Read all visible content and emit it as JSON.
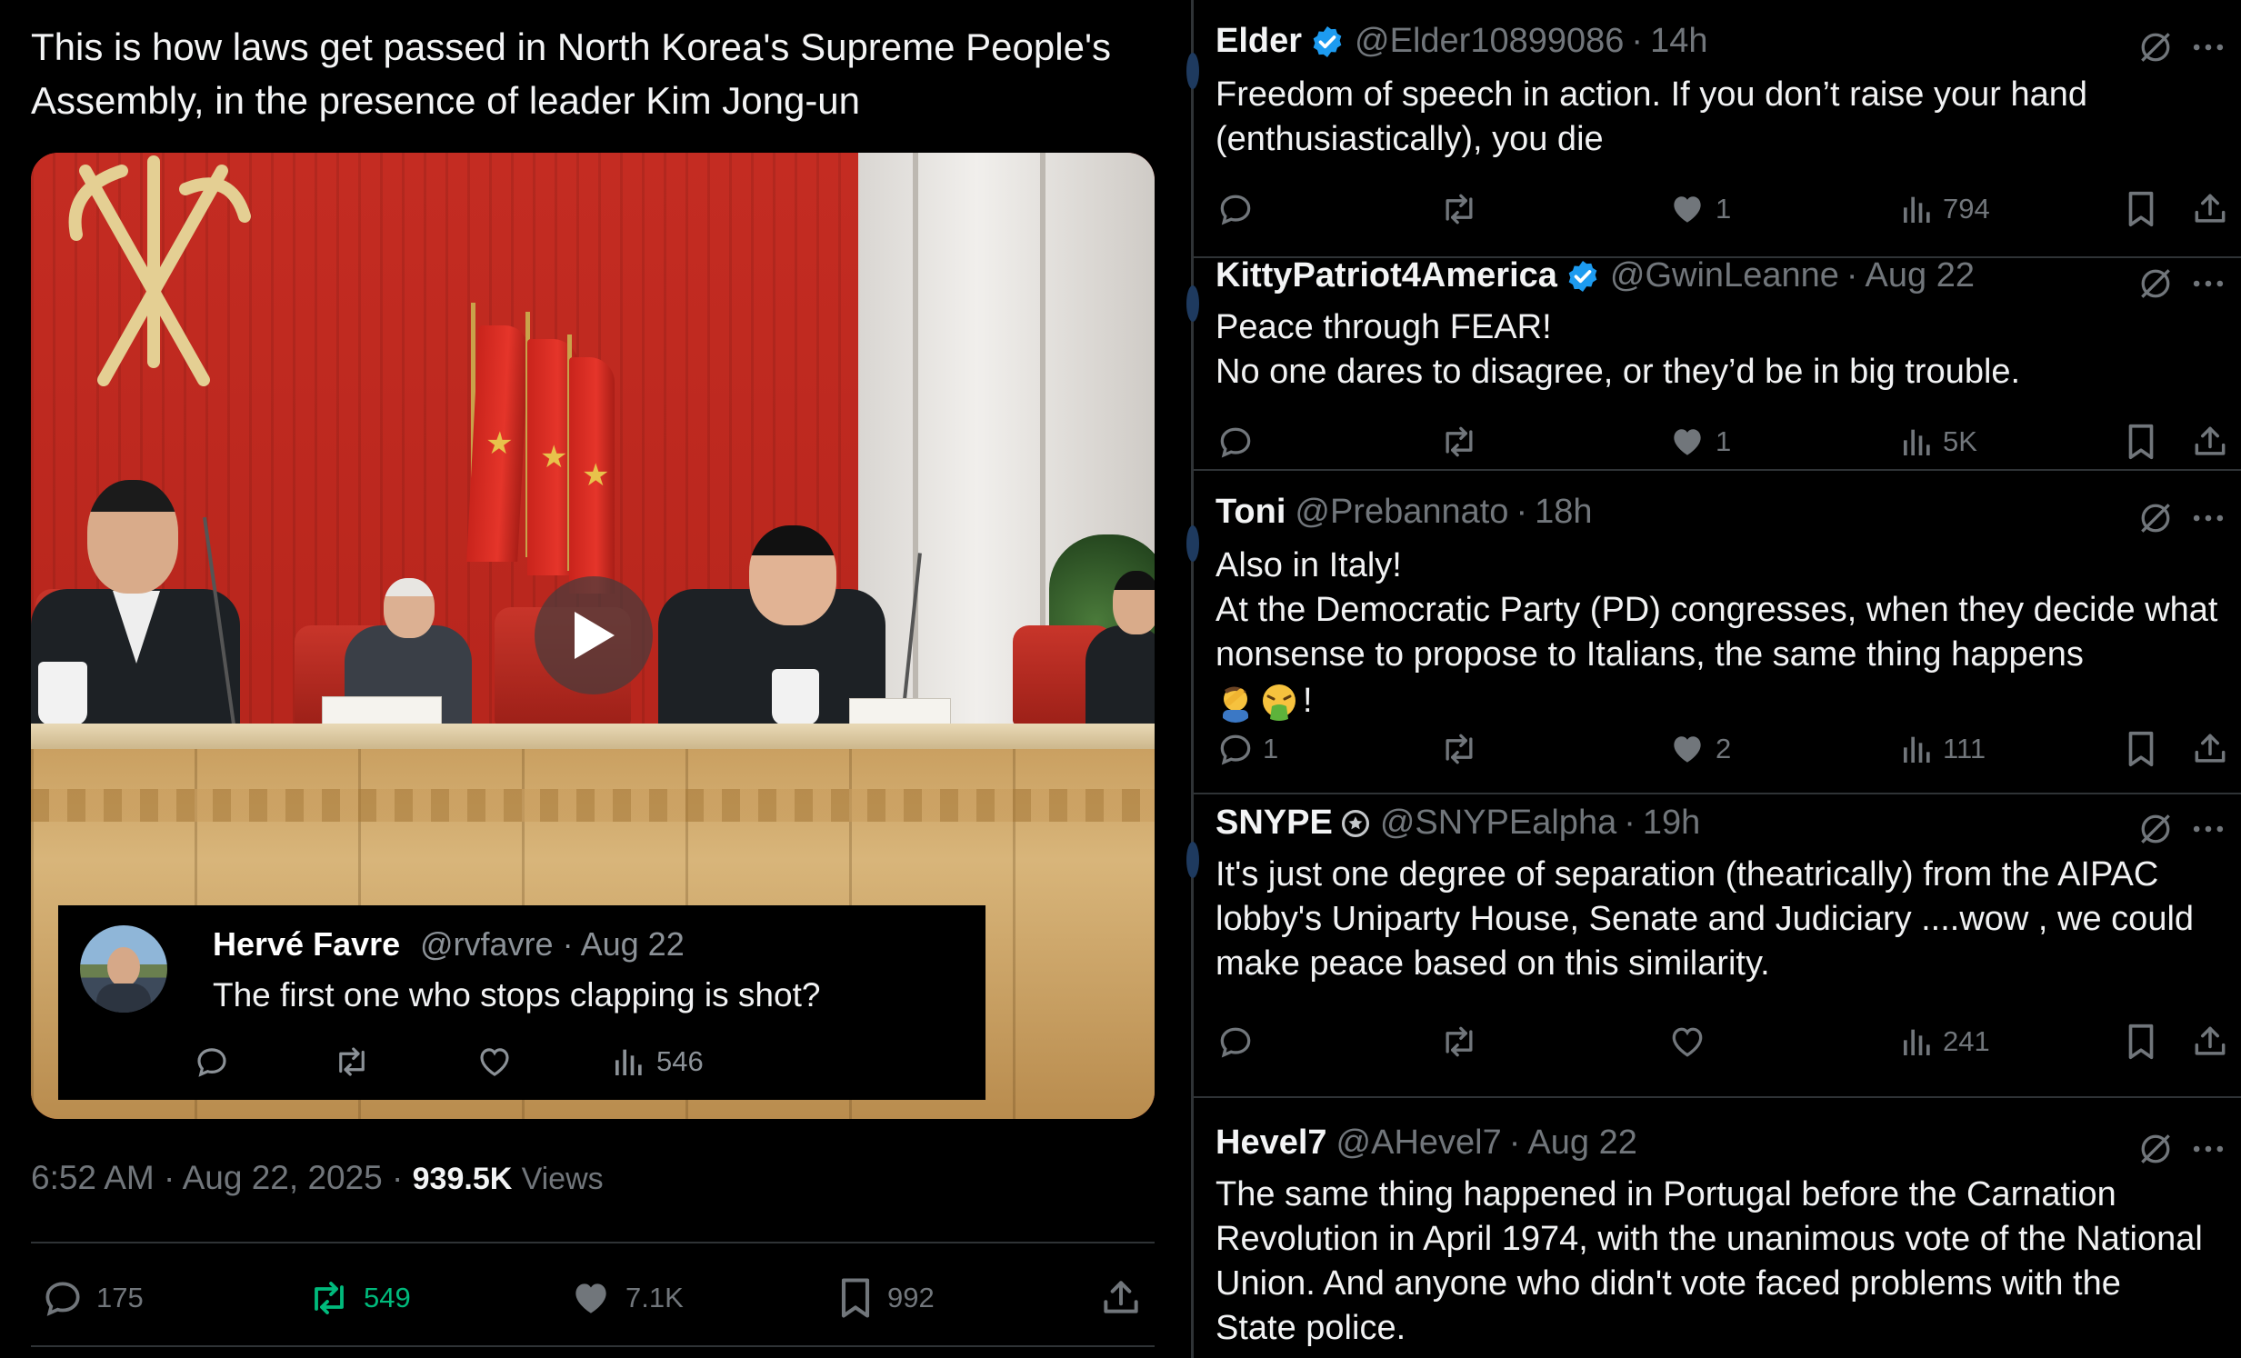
{
  "main_post": {
    "text": "This is how laws get passed in North Korea's Supreme People's Assembly, in the presence of leader Kim Jong-un",
    "time": "6:52 AM",
    "date": "Aug 22, 2025",
    "views_count": "939.5K",
    "views_label": "Views",
    "replies": "175",
    "reposts": "549",
    "likes": "7.1K",
    "bookmarks": "992",
    "colors": {
      "repost_active": "#00ba7c",
      "text_muted": "#71767b"
    }
  },
  "quoted_reply": {
    "name": "Hervé Favre",
    "handle": "@rvfavre",
    "date": "Aug 22",
    "text": "The first one who stops clapping is shot?",
    "views": "546"
  },
  "replies": [
    {
      "name": "Elder",
      "verified": "blue",
      "handle": "@Elder10899086",
      "time": "14h",
      "lines": [
        "Freedom of speech in action. If you don’t raise your hand",
        "(enthusiastically), you die"
      ],
      "replies": "",
      "likes": "1",
      "views": "794"
    },
    {
      "name": "KittyPatriot4America",
      "verified": "blue",
      "handle": "@GwinLeanne",
      "time": "Aug 22",
      "lines": [
        "Peace through FEAR!",
        "No one dares to disagree, or they’d be in big trouble."
      ],
      "replies": "",
      "likes": "1",
      "views": "5K"
    },
    {
      "name": "Toni",
      "verified": "",
      "handle": "@Prebannato",
      "time": "18h",
      "lines": [
        "Also in Italy!",
        "At the Democratic Party (PD) congresses, when they decide what",
        "nonsense to propose to Italians, the same thing happens",
        "!"
      ],
      "emojis": [
        "man-facepalming-emoji",
        "face-vomiting-emoji"
      ],
      "replies": "1",
      "likes": "2",
      "views": "111"
    },
    {
      "name": "SNYPE",
      "verified": "gray",
      "handle": "@SNYPEalpha",
      "time": "19h",
      "lines": [
        "It's just one degree of separation (theatrically) from the AIPAC",
        "lobby's Uniparty House, Senate and Judiciary ....wow , we could",
        "make peace based on this similarity."
      ],
      "replies": "",
      "likes": "",
      "views": "241"
    },
    {
      "name": "Hevel7",
      "verified": "",
      "handle": "@AHevel7",
      "time": "Aug 22",
      "lines": [
        "The same thing happened in Portugal before the Carnation",
        "Revolution in April 1974, with the unanimous vote of the National",
        "Union. And anyone who didn't vote faced problems with the",
        "State police."
      ]
    }
  ],
  "colors": {
    "background": "#000000",
    "verified_blue": "#1d9bf0",
    "divider": "#2f3336",
    "muted": "#71767b"
  }
}
